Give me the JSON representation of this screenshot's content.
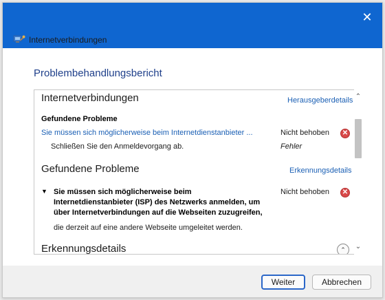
{
  "window": {
    "title": "Internetverbindungen",
    "close_glyph": "✕"
  },
  "heading": "Problembehandlungsbericht",
  "report": {
    "section1": {
      "title": "Internetverbindungen",
      "details_link": "Herausgeberdetails",
      "found_label": "Gefundene Probleme",
      "problem_link": "Sie müssen sich möglicherweise beim Internetdienstanbieter ...",
      "problem_status": "Nicht behoben",
      "step_text": "Schließen Sie den Anmeldevorgang ab.",
      "step_status": "Fehler"
    },
    "section2": {
      "title": "Gefundene Probleme",
      "details_link": "Erkennungsdetails",
      "expand_glyph": "▼",
      "problem_line1": "Sie müssen sich möglicherweise beim",
      "problem_line2": "Internetdienstanbieter (ISP) des Netzwerks anmelden, um",
      "problem_line3": "über Internetverbindungen auf die Webseiten zuzugreifen,",
      "problem_status": "Nicht behoben",
      "description": "die derzeit auf eine andere Webseite umgeleitet werden."
    },
    "section3": {
      "title": "Erkennungsdetails",
      "collapse_glyph": "⌃"
    },
    "error_glyph": "✕",
    "scroll_up_glyph": "⌃",
    "scroll_down_glyph": "⌄"
  },
  "buttons": {
    "next": "Weiter",
    "cancel": "Abbrechen"
  },
  "colors": {
    "titlebar": "#0f66d0",
    "heading": "#1e3f8a",
    "link": "#1a5fb4",
    "error": "#d84a4a"
  }
}
